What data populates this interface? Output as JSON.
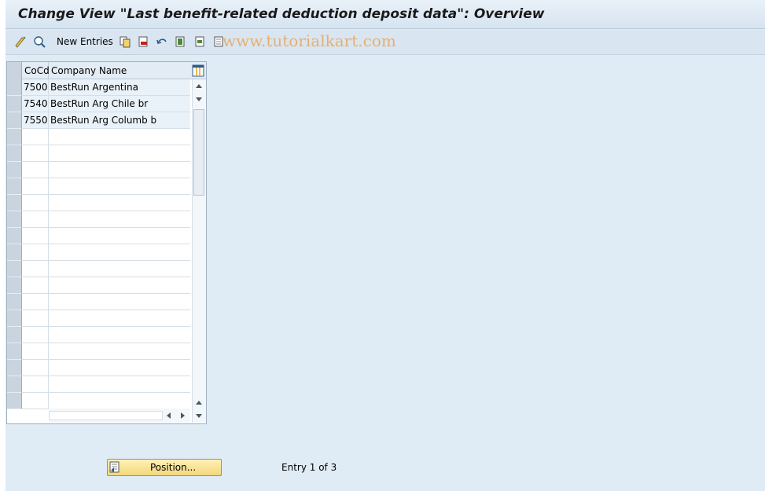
{
  "window": {
    "title": "Change View \"Last benefit-related deduction deposit data\": Overview"
  },
  "toolbar": {
    "new_entries_label": "New Entries",
    "icons": [
      "edit-icon",
      "display-change-icon",
      "copy-icon",
      "delete-icon",
      "undo-icon",
      "select-all-icon",
      "select-block-icon",
      "deselect-all-icon"
    ]
  },
  "watermark": "www.tutorialkart.com",
  "table": {
    "columns": [
      "CoCd",
      "Company Name"
    ],
    "rows": [
      {
        "cocd": "7500",
        "name": "BestRun Argentina"
      },
      {
        "cocd": "7540",
        "name": "BestRun Arg Chile br"
      },
      {
        "cocd": "7550",
        "name": "BestRun Arg Columb b"
      }
    ]
  },
  "footer": {
    "position_button_label": "Position...",
    "entry_info": "Entry 1 of 3"
  }
}
